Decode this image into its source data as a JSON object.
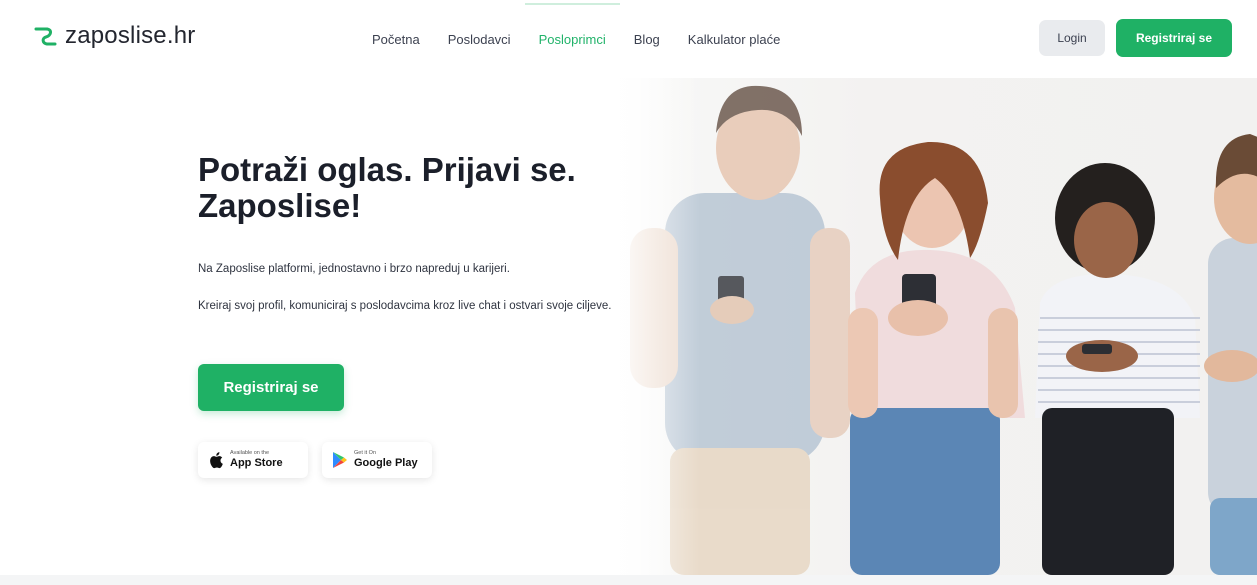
{
  "header": {
    "logo_text": "zaposlise.hr",
    "nav": [
      {
        "label": "Početna",
        "active": false
      },
      {
        "label": "Poslodavci",
        "active": false
      },
      {
        "label": "Posloprimci",
        "active": true
      },
      {
        "label": "Blog",
        "active": false
      },
      {
        "label": "Kalkulator plaće",
        "active": false
      }
    ],
    "login_label": "Login",
    "register_label": "Registriraj se"
  },
  "hero": {
    "title": "Potraži oglas. Prijavi se. Zaposlise!",
    "paragraph_1": "Na Zaposlise platformi, jednostavno i brzo napreduj u karijeri.",
    "paragraph_2": "Kreiraj svoj profil, komuniciraj s poslodavcima kroz live chat i ostvari svoje ciljeve.",
    "register_label": "Registriraj se",
    "app_store": {
      "small": "Available on the",
      "big": "App Store",
      "icon": "apple-icon"
    },
    "google_play": {
      "small": "Get it On",
      "big": "Google Play",
      "icon": "google-play-icon"
    }
  },
  "colors": {
    "brand_green": "#1fb165",
    "active_nav": "#21b36a",
    "login_bg": "#e9ebee",
    "title": "#1b1f2a"
  }
}
